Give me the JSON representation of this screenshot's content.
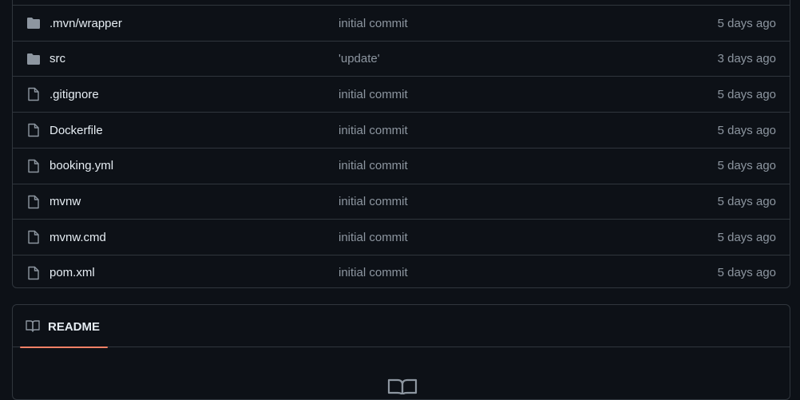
{
  "files": [
    {
      "name": ".mvn/wrapper",
      "type": "folder",
      "icon": "folder-icon",
      "message": "initial commit",
      "time": "5 days ago"
    },
    {
      "name": "src",
      "type": "folder",
      "icon": "folder-icon",
      "message": "'update'",
      "time": "3 days ago"
    },
    {
      "name": ".gitignore",
      "type": "file",
      "icon": "file-icon",
      "message": "initial commit",
      "time": "5 days ago"
    },
    {
      "name": "Dockerfile",
      "type": "file",
      "icon": "file-icon",
      "message": "initial commit",
      "time": "5 days ago"
    },
    {
      "name": "booking.yml",
      "type": "file",
      "icon": "file-icon",
      "message": "initial commit",
      "time": "5 days ago"
    },
    {
      "name": "mvnw",
      "type": "file",
      "icon": "file-icon",
      "message": "initial commit",
      "time": "5 days ago"
    },
    {
      "name": "mvnw.cmd",
      "type": "file",
      "icon": "file-icon",
      "message": "initial commit",
      "time": "5 days ago"
    },
    {
      "name": "pom.xml",
      "type": "file",
      "icon": "file-icon",
      "message": "initial commit",
      "time": "5 days ago"
    }
  ],
  "readme": {
    "tab_label": "README",
    "tab_icon": "book-icon",
    "body_icon": "book-icon"
  },
  "colors": {
    "background": "#0d1117",
    "border": "#30363d",
    "text": "#e6edf3",
    "muted": "#8d96a0",
    "icon": "#8d96a0",
    "accent_underline": "#f78166"
  }
}
